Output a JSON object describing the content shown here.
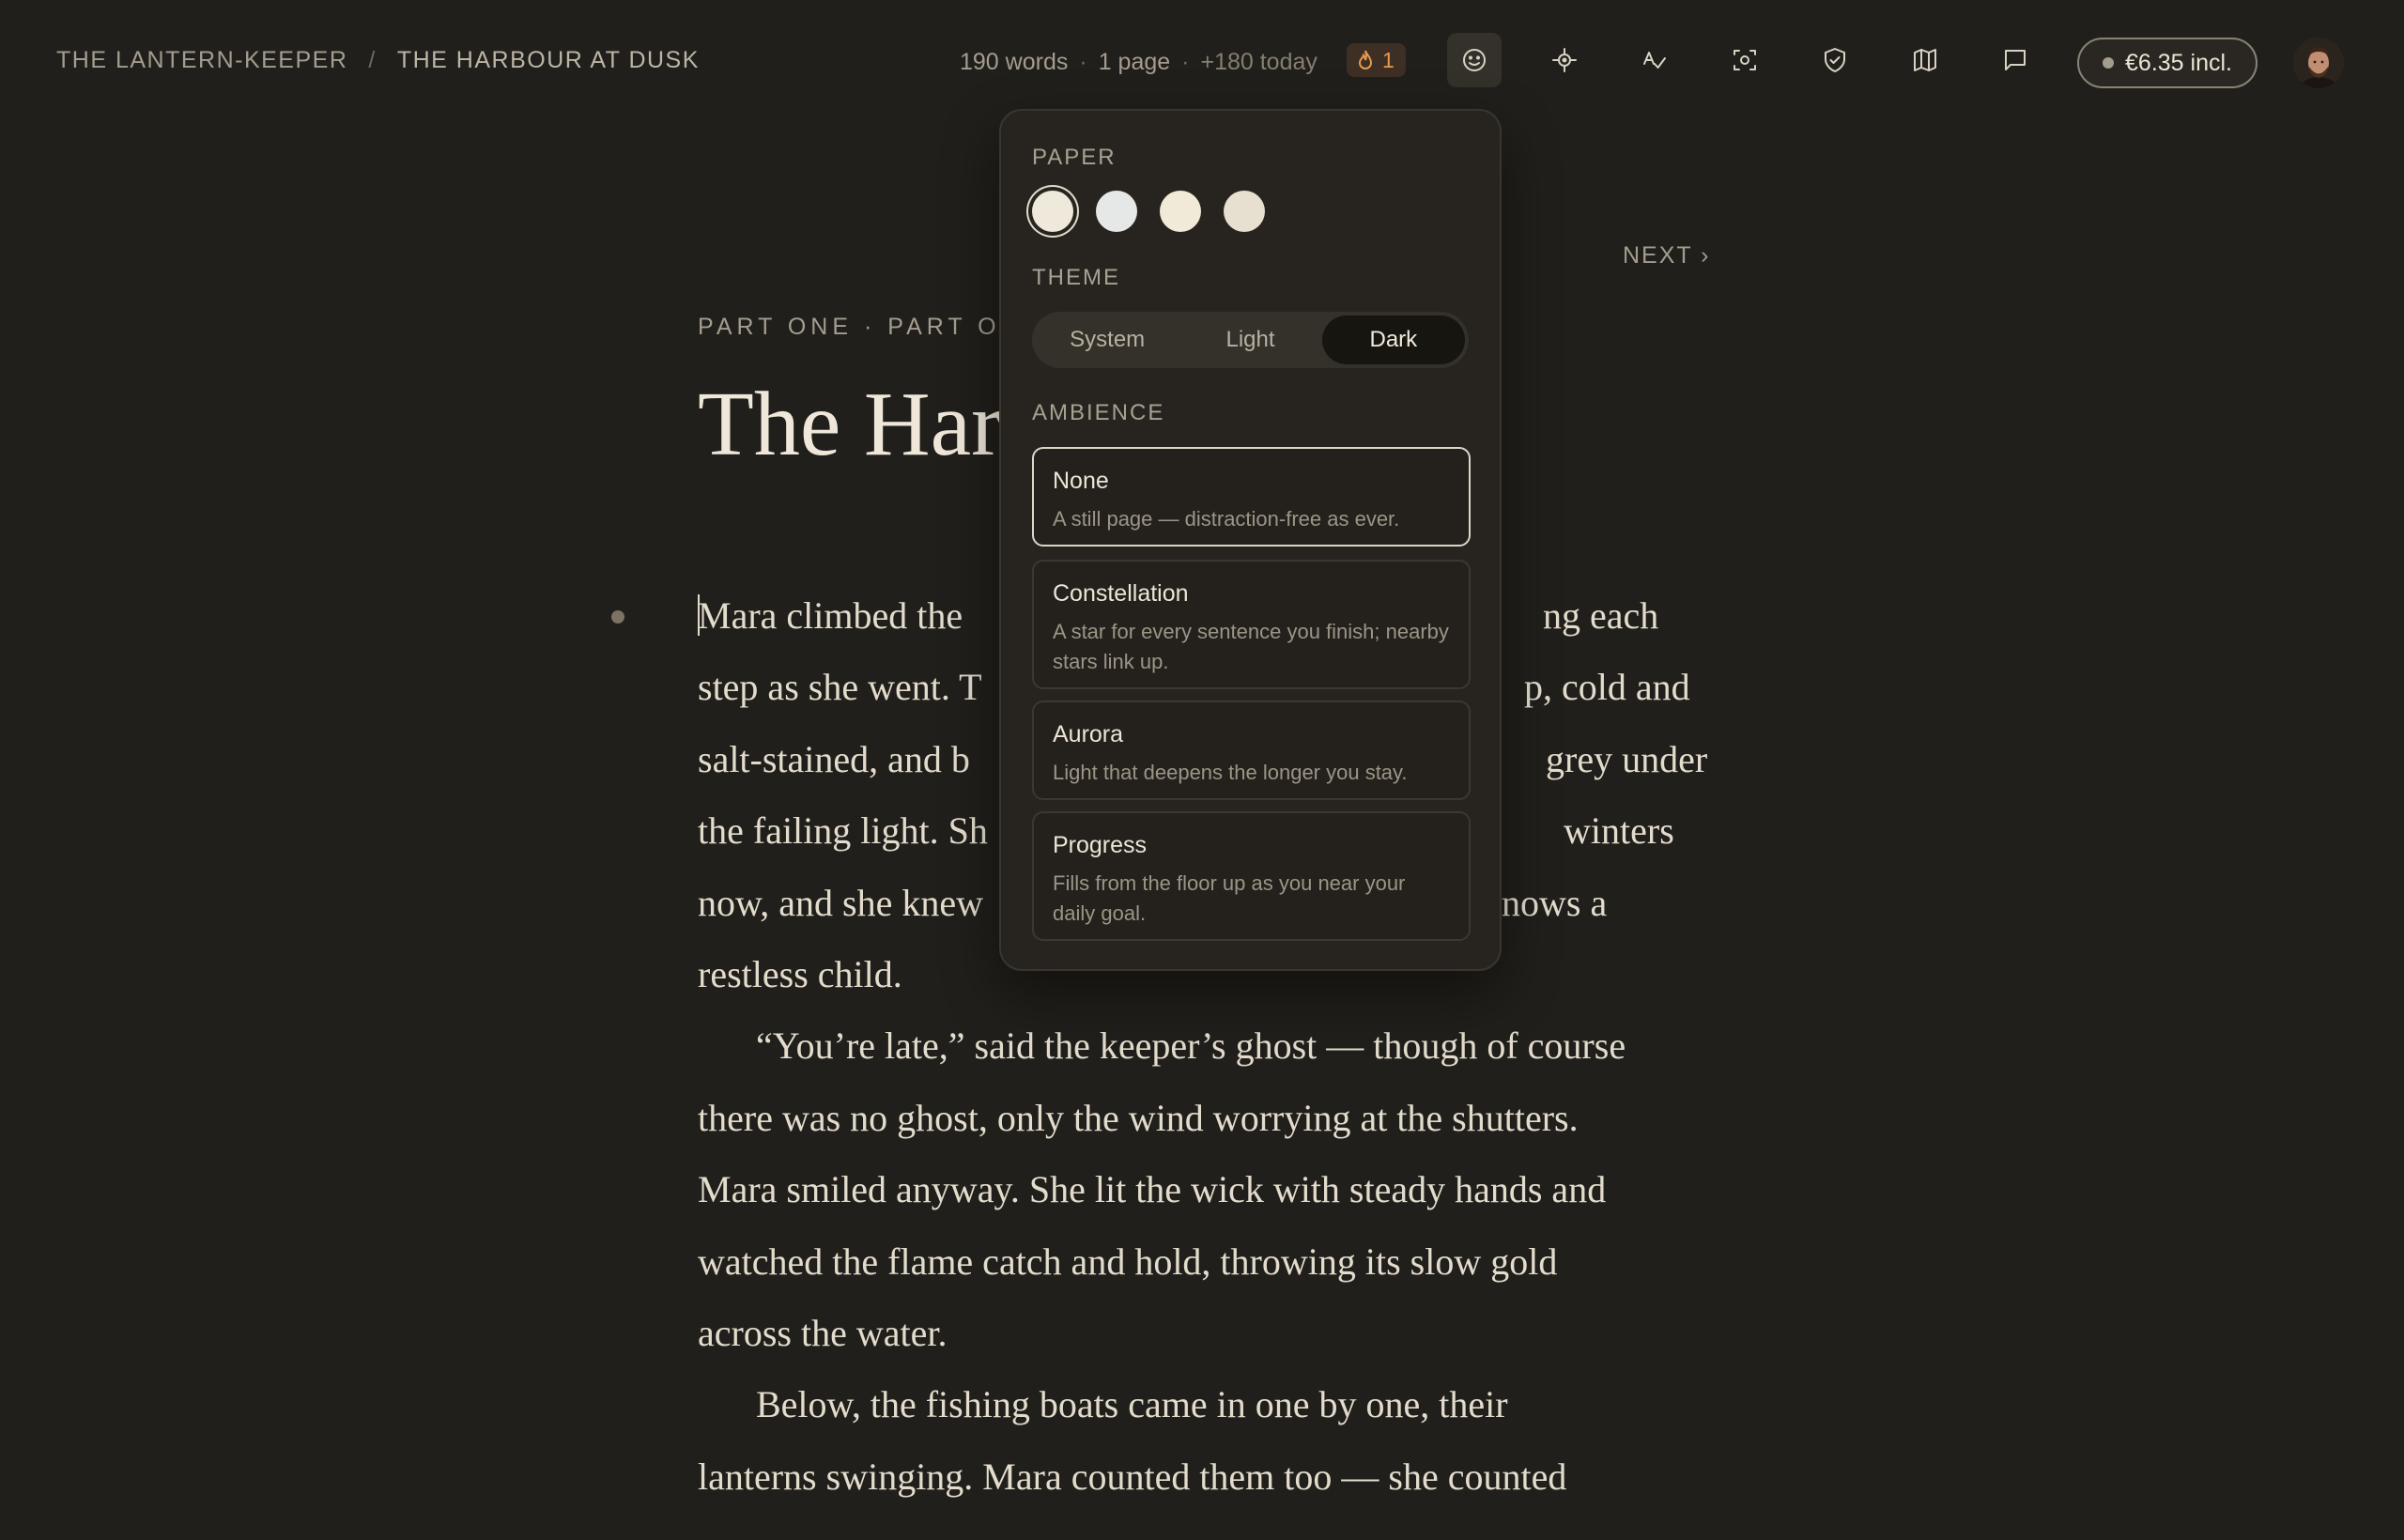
{
  "breadcrumb": {
    "project": "THE LANTERN-KEEPER",
    "separator": "/",
    "chapter": "THE HARBOUR AT DUSK"
  },
  "stats": {
    "words": "190 words",
    "pages": "1 page",
    "today": "+180 today",
    "streak": "1"
  },
  "toolbar": {
    "items": [
      "ambience-icon",
      "focus-icon",
      "spellcheck-icon",
      "snapshot-icon",
      "privacy-shield-icon",
      "map-icon",
      "comments-icon"
    ]
  },
  "price": {
    "label": "€6.35 incl."
  },
  "nav": {
    "next": "NEXT ›"
  },
  "chapter": {
    "label": "PART ONE · PART ON",
    "title": "The Har"
  },
  "body_lines": [
    {
      "text": "Mara climbed the",
      "right": "ng each"
    },
    {
      "text": "step as she went. T",
      "right": "p, cold and"
    },
    {
      "text": "salt-stained, and b",
      "right": "grey under"
    },
    {
      "text": "the failing light. Sh",
      "right": "winters"
    },
    {
      "text": "now, and she knew",
      "right": "nows a"
    },
    {
      "text": "restless child.",
      "right": ""
    },
    {
      "text": "“You’re late,” said the keeper’s ghost — though of course",
      "right": ""
    },
    {
      "text": "there was no ghost, only the wind worrying at the shutters.",
      "right": ""
    },
    {
      "text": "Mara smiled anyway. She lit the wick with steady hands and",
      "right": ""
    },
    {
      "text": "watched the flame catch and hold, throwing its slow gold",
      "right": ""
    },
    {
      "text": "across the water.",
      "right": ""
    },
    {
      "text": "Below, the fishing boats came in one by one, their",
      "right": ""
    },
    {
      "text": "lanterns swinging. Mara counted them too — she counted",
      "right": ""
    }
  ],
  "popover": {
    "paper_label": "PAPER",
    "paper_colors": [
      "#efe9dc",
      "#e6e8e8",
      "#f2ead8",
      "#e7dfcf"
    ],
    "paper_selected": 0,
    "theme_label": "THEME",
    "themes": [
      "System",
      "Light",
      "Dark"
    ],
    "theme_selected": "Dark",
    "ambience_label": "AMBIENCE",
    "ambiences": [
      {
        "title": "None",
        "desc": "A still page — distraction-free as ever.",
        "selected": true
      },
      {
        "title": "Constellation",
        "desc": "A star for every sentence you finish; nearby stars link up.",
        "selected": false
      },
      {
        "title": "Aurora",
        "desc": "Light that deepens the longer you stay.",
        "selected": false
      },
      {
        "title": "Progress",
        "desc": "Fills from the floor up as you near your daily goal.",
        "selected": false
      }
    ]
  },
  "colors": {
    "background": "#211f1b",
    "accent_streak": "#e59a4f",
    "text": "#e3dccd"
  }
}
